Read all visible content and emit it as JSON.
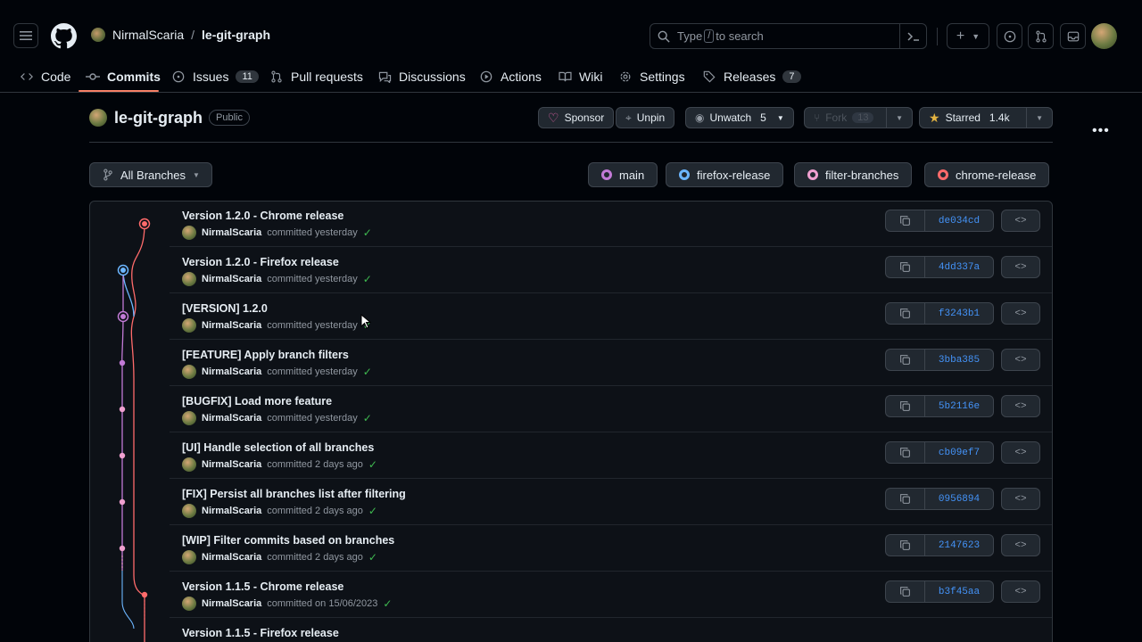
{
  "header": {
    "owner": "NirmalScaria",
    "separator": "/",
    "repo": "le-git-graph",
    "search": {
      "prefix": "Type",
      "key": "/",
      "suffix": "to search"
    }
  },
  "nav": {
    "items": [
      {
        "label": "Code",
        "icon": "code-icon"
      },
      {
        "label": "Commits",
        "icon": "commit-icon",
        "active": true
      },
      {
        "label": "Issues",
        "icon": "issue-icon",
        "count": "11"
      },
      {
        "label": "Pull requests",
        "icon": "pull-request-icon"
      },
      {
        "label": "Discussions",
        "icon": "discussion-icon"
      },
      {
        "label": "Actions",
        "icon": "play-icon"
      },
      {
        "label": "Wiki",
        "icon": "book-icon"
      },
      {
        "label": "Settings",
        "icon": "gear-icon"
      },
      {
        "label": "Releases",
        "icon": "tag-icon",
        "count": "7"
      }
    ]
  },
  "repo": {
    "name": "le-git-graph",
    "visibility": "Public",
    "sponsor": "Sponsor",
    "unpin": "Unpin",
    "unwatch": "Unwatch",
    "watch_count": "5",
    "fork": "Fork",
    "fork_count": "13",
    "starred": "Starred",
    "star_count": "1.4k"
  },
  "branches": {
    "all_label": "All Branches",
    "chips": [
      {
        "name": "main",
        "color": "#c27ad6"
      },
      {
        "name": "firefox-release",
        "color": "#6cb6ff"
      },
      {
        "name": "filter-branches",
        "color": "#f0a0d0"
      },
      {
        "name": "chrome-release",
        "color": "#ff6b6b"
      }
    ]
  },
  "commits": [
    {
      "title": "Version 1.2.0 - Chrome release",
      "author": "NirmalScaria",
      "when": "committed yesterday",
      "sha": "de034cd"
    },
    {
      "title": "Version 1.2.0 - Firefox release",
      "author": "NirmalScaria",
      "when": "committed yesterday",
      "sha": "4dd337a"
    },
    {
      "title": "[VERSION] 1.2.0",
      "author": "NirmalScaria",
      "when": "committed yesterday",
      "sha": "f3243b1"
    },
    {
      "title": "[FEATURE] Apply branch filters",
      "author": "NirmalScaria",
      "when": "committed yesterday",
      "sha": "3bba385"
    },
    {
      "title": "[BUGFIX] Load more feature",
      "author": "NirmalScaria",
      "when": "committed yesterday",
      "sha": "5b2116e"
    },
    {
      "title": "[UI] Handle selection of all branches",
      "author": "NirmalScaria",
      "when": "committed 2 days ago",
      "sha": "cb09ef7"
    },
    {
      "title": "[FIX] Persist all branches list after filtering",
      "author": "NirmalScaria",
      "when": "committed 2 days ago",
      "sha": "0956894"
    },
    {
      "title": "[WIP] Filter commits based on branches",
      "author": "NirmalScaria",
      "when": "committed 2 days ago",
      "sha": "2147623"
    },
    {
      "title": "Version 1.1.5 - Chrome release",
      "author": "NirmalScaria",
      "when": "committed on 15/06/2023",
      "sha": "b3f45aa"
    },
    {
      "title": "Version 1.1.5 - Firefox release",
      "author": "",
      "when": "",
      "sha": ""
    }
  ],
  "code_btn": "<>"
}
